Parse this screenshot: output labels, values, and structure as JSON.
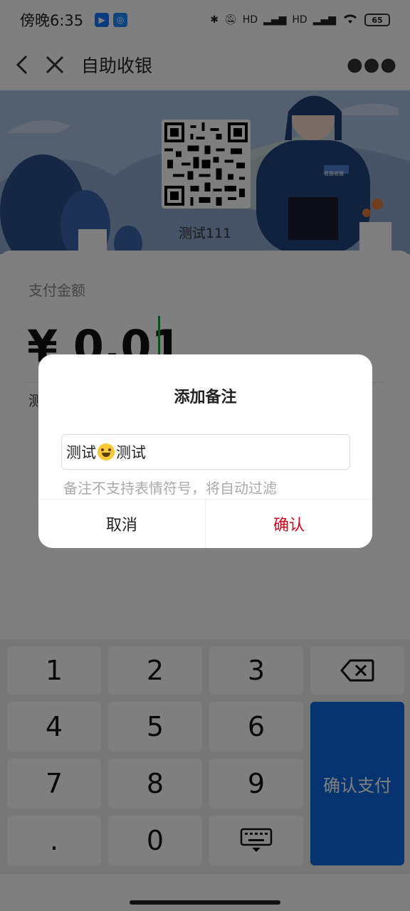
{
  "status_bar": {
    "time": "傍晚6:35",
    "battery": "65",
    "signal_hd_1": "HD",
    "signal_hd_2": "HD"
  },
  "nav": {
    "title": "自助收银"
  },
  "banner": {
    "qr_caption": "测试111",
    "badge_text": "收银收银"
  },
  "payment": {
    "amount_label": "支付金额",
    "amount": "¥ 0.01",
    "note_peek": "测"
  },
  "dialog": {
    "title": "添加备注",
    "input_before": "测试",
    "input_after": "测试",
    "hint": "备注不支持表情符号，将自动过滤",
    "cancel": "取消",
    "confirm": "确认",
    "confirm_color": "#d0021b"
  },
  "keypad": {
    "keys": [
      "1",
      "2",
      "3",
      "4",
      "5",
      "6",
      "7",
      "8",
      "9",
      ".",
      "0"
    ],
    "pay_label": "确认支付",
    "accent": "#0a68e0"
  }
}
